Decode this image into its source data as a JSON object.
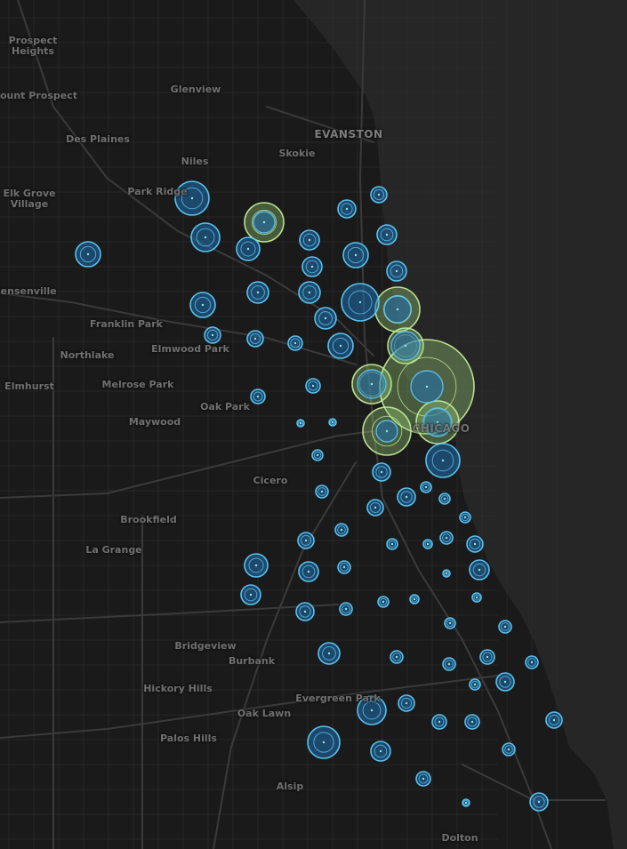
{
  "map": {
    "colors": {
      "land": "#1a1a1a",
      "water": "#262626",
      "road": "#2e2e2e",
      "highway": "#3a3a3a",
      "label": "#6f6f6f",
      "circle_blue_fill": "#1f6fb0",
      "circle_blue_stroke": "#5fd0ff",
      "circle_green_fill": "#9fd47a",
      "circle_green_stroke": "#c6f29a",
      "dot": "#8fe8e0"
    },
    "places": [
      {
        "text": "Prospect\nHeights"
      },
      {
        "text": "Mount Prospect"
      },
      {
        "text": "Glenview"
      },
      {
        "text": "Des Plaines"
      },
      {
        "text": "EVANSTON"
      },
      {
        "text": "Niles"
      },
      {
        "text": "Skokie"
      },
      {
        "text": "Elk Grove\nVillage"
      },
      {
        "text": "Park Ridge"
      },
      {
        "text": "Bensenville"
      },
      {
        "text": "Franklin Park"
      },
      {
        "text": "Northlake"
      },
      {
        "text": "Elmwood Park"
      },
      {
        "text": "Elmhurst"
      },
      {
        "text": "Melrose Park"
      },
      {
        "text": "Oak Park"
      },
      {
        "text": "Maywood"
      },
      {
        "text": "CHICAGO"
      },
      {
        "text": "Cicero"
      },
      {
        "text": "Brookfield"
      },
      {
        "text": "La Grange"
      },
      {
        "text": "Bridgeview"
      },
      {
        "text": "Burbank"
      },
      {
        "text": "Hickory Hills"
      },
      {
        "text": "Evergreen Park"
      },
      {
        "text": "Oak Lawn"
      },
      {
        "text": "Palos Hills"
      },
      {
        "text": "Alsip"
      },
      {
        "text": "Dolton"
      }
    ],
    "stations_blue": [
      [
        216,
        223,
        19
      ],
      [
        231,
        267,
        16
      ],
      [
        99,
        286,
        14
      ],
      [
        279,
        280,
        13
      ],
      [
        228,
        343,
        14
      ],
      [
        290,
        329,
        12
      ],
      [
        239,
        377,
        9
      ],
      [
        287,
        381,
        9
      ],
      [
        332,
        386,
        8
      ],
      [
        290,
        446,
        8
      ],
      [
        352,
        434,
        8
      ],
      [
        338,
        476,
        4
      ],
      [
        374,
        475,
        4
      ],
      [
        357,
        512,
        6
      ],
      [
        362,
        553,
        7
      ],
      [
        348,
        270,
        11
      ],
      [
        351,
        300,
        11
      ],
      [
        348,
        329,
        12
      ],
      [
        366,
        358,
        12
      ],
      [
        383,
        389,
        14
      ],
      [
        400,
        287,
        14
      ],
      [
        390,
        235,
        10
      ],
      [
        426,
        219,
        9
      ],
      [
        435,
        264,
        11
      ],
      [
        446,
        305,
        11
      ],
      [
        405,
        340,
        21
      ],
      [
        498,
        518,
        19
      ],
      [
        429,
        531,
        10
      ],
      [
        457,
        559,
        10
      ],
      [
        479,
        548,
        6
      ],
      [
        500,
        561,
        6
      ],
      [
        523,
        582,
        6
      ],
      [
        422,
        571,
        9
      ],
      [
        384,
        596,
        7
      ],
      [
        441,
        612,
        6
      ],
      [
        481,
        612,
        5
      ],
      [
        502,
        605,
        7
      ],
      [
        534,
        612,
        9
      ],
      [
        344,
        608,
        9
      ],
      [
        288,
        636,
        13
      ],
      [
        387,
        638,
        7
      ],
      [
        347,
        643,
        11
      ],
      [
        502,
        645,
        4
      ],
      [
        539,
        641,
        11
      ],
      [
        282,
        669,
        11
      ],
      [
        343,
        688,
        10
      ],
      [
        389,
        685,
        7
      ],
      [
        431,
        677,
        6
      ],
      [
        466,
        674,
        5
      ],
      [
        506,
        701,
        6
      ],
      [
        536,
        672,
        5
      ],
      [
        568,
        705,
        7
      ],
      [
        370,
        735,
        12
      ],
      [
        446,
        739,
        7
      ],
      [
        505,
        747,
        7
      ],
      [
        548,
        739,
        8
      ],
      [
        598,
        745,
        7
      ],
      [
        534,
        770,
        6
      ],
      [
        568,
        767,
        10
      ],
      [
        418,
        799,
        16
      ],
      [
        457,
        791,
        9
      ],
      [
        494,
        812,
        8
      ],
      [
        531,
        812,
        8
      ],
      [
        623,
        810,
        9
      ],
      [
        364,
        835,
        18
      ],
      [
        428,
        845,
        11
      ],
      [
        572,
        843,
        7
      ],
      [
        476,
        876,
        8
      ],
      [
        524,
        903,
        4
      ],
      [
        606,
        902,
        10
      ]
    ],
    "stations_green": [
      [
        297,
        250,
        22
      ],
      [
        447,
        348,
        25
      ],
      [
        456,
        389,
        20
      ],
      [
        418,
        432,
        22
      ],
      [
        480,
        435,
        53
      ],
      [
        492,
        475,
        24
      ],
      [
        435,
        485,
        27
      ]
    ],
    "stations_inner_blue": [
      [
        456,
        389,
        16
      ],
      [
        480,
        435,
        18
      ],
      [
        492,
        475,
        16
      ],
      [
        435,
        485,
        12
      ],
      [
        447,
        348,
        15
      ],
      [
        418,
        432,
        16
      ],
      [
        297,
        250,
        12
      ]
    ]
  }
}
